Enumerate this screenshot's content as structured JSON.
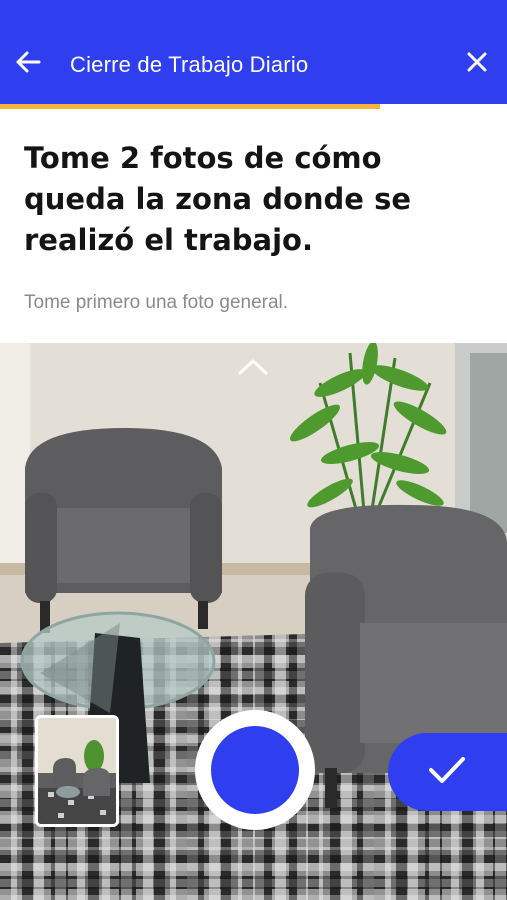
{
  "header": {
    "title": "Cierre de Trabajo Diario",
    "back_icon": "arrow-left-icon",
    "close_icon": "close-icon",
    "background_color": "#2f3ff0",
    "progress_color": "#f4b63a",
    "progress_fraction": 0.75
  },
  "instructions": {
    "heading": "Tome 2 fotos de cómo queda la zona donde se realizó el trabajo.",
    "subtext": "Tome primero una foto general."
  },
  "camera": {
    "expand_icon": "chevron-up-icon",
    "shutter_color": "#2f3ff0",
    "confirm_icon": "checkmark-icon"
  }
}
